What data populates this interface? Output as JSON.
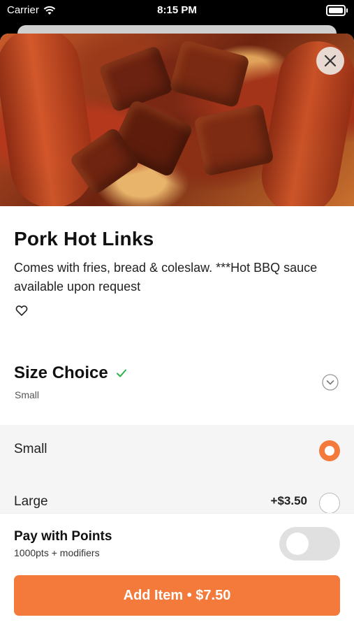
{
  "status_bar": {
    "carrier": "Carrier",
    "time": "8:15 PM"
  },
  "item": {
    "name": "Pork Hot Links",
    "description": "Comes with fries, bread & coleslaw. ***Hot BBQ sauce available upon request"
  },
  "size_choice": {
    "title": "Size Choice",
    "selected_summary": "Small",
    "options": [
      {
        "label": "Small",
        "price": "",
        "selected": true
      },
      {
        "label": "Large",
        "price": "+$3.50",
        "selected": false
      }
    ]
  },
  "pay_with_points": {
    "title": "Pay with Points",
    "subtitle": "1000pts + modifiers",
    "enabled": false
  },
  "add_button": {
    "label": "Add Item • $7.50"
  },
  "colors": {
    "accent": "#f47a3c",
    "success": "#2bb04a"
  },
  "icons": [
    "wifi-icon",
    "battery-icon",
    "close-icon",
    "heart-icon",
    "checkmark-icon",
    "chevron-down-icon"
  ]
}
